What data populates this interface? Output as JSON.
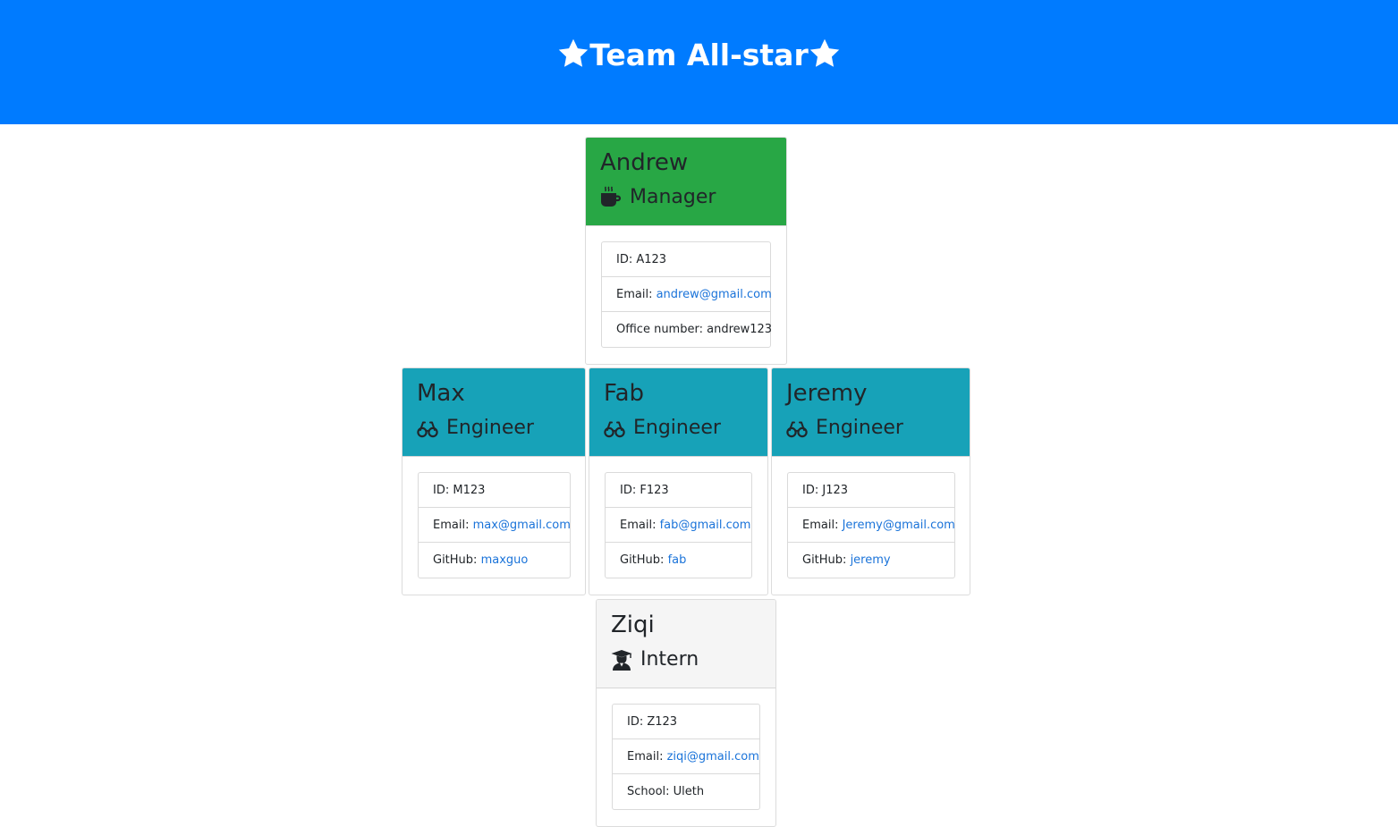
{
  "header": {
    "title": "Team All-star"
  },
  "colors": {
    "header_bg": "#007bff",
    "manager_bg": "#28a745",
    "engineer_bg": "#17a2b8",
    "intern_bg": "#f5f5f5",
    "link": "#1a73d9"
  },
  "employees": {
    "andrew": {
      "name": "Andrew",
      "role": "Manager",
      "icon": "coffee-icon",
      "id_label": "ID: ",
      "id": "A123",
      "email_label": "Email: ",
      "email": "andrew@gmail.com",
      "extra_label": "Office number: ",
      "extra": "andrew123"
    },
    "max": {
      "name": "Max",
      "role": "Engineer",
      "icon": "glasses-icon",
      "id_label": "ID: ",
      "id": "M123",
      "email_label": "Email: ",
      "email": "max@gmail.com",
      "extra_label": "GitHub: ",
      "extra": "maxguo"
    },
    "fab": {
      "name": "Fab",
      "role": "Engineer",
      "icon": "glasses-icon",
      "id_label": "ID: ",
      "id": "F123",
      "email_label": "Email: ",
      "email": "fab@gmail.com",
      "extra_label": "GitHub: ",
      "extra": "fab"
    },
    "jeremy": {
      "name": "Jeremy",
      "role": "Engineer",
      "icon": "glasses-icon",
      "id_label": "ID: ",
      "id": "J123",
      "email_label": "Email: ",
      "email": "Jeremy@gmail.com",
      "extra_label": "GitHub: ",
      "extra": "jeremy"
    },
    "ziqi": {
      "name": "Ziqi",
      "role": "Intern",
      "icon": "graduate-icon",
      "id_label": "ID: ",
      "id": "Z123",
      "email_label": "Email: ",
      "email": "ziqi@gmail.com",
      "extra_label": "School: ",
      "extra": "Uleth"
    }
  }
}
